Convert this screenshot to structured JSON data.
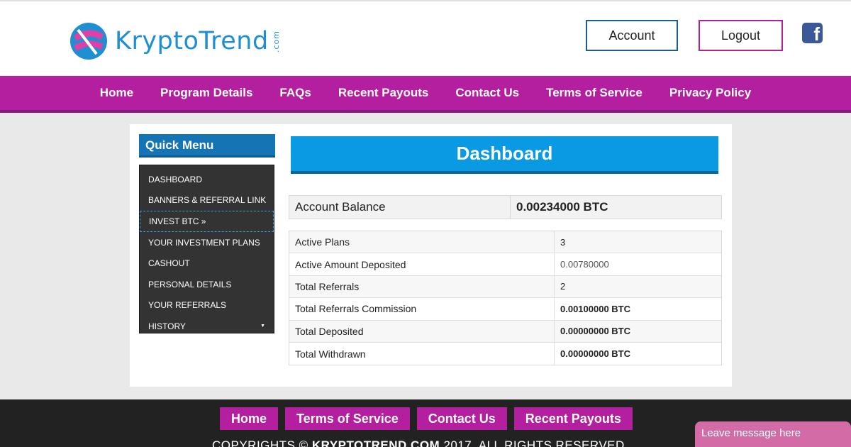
{
  "header": {
    "logo_text": "KryptoTrend",
    "logo_suffix": ".com",
    "account_label": "Account",
    "logout_label": "Logout",
    "facebook_glyph": "f"
  },
  "nav": {
    "items": [
      "Home",
      "Program Details",
      "FAQs",
      "Recent Payouts",
      "Contact Us",
      "Terms of Service",
      "Privacy Policy"
    ]
  },
  "quick_menu": {
    "title": "Quick Menu",
    "items": [
      "DASHBOARD",
      "BANNERS & REFERRAL LINK",
      "INVEST BTC »",
      "YOUR INVESTMENT PLANS",
      "CASHOUT",
      "PERSONAL DETAILS",
      "YOUR REFERRALS",
      "HISTORY"
    ],
    "active_index": 2
  },
  "dashboard": {
    "title": "Dashboard",
    "balance_label": "Account Balance",
    "balance_value": "0.00234000 BTC",
    "stats": [
      {
        "label": "Active Plans",
        "value": "3"
      },
      {
        "label": "Active Amount Deposited",
        "value": "0.00780000"
      },
      {
        "label": "Total Referrals",
        "value": "2"
      },
      {
        "label": "Total Referrals Commission",
        "value": "0.00100000 BTC"
      },
      {
        "label": "Total Deposited",
        "value": "0.00000000 BTC"
      },
      {
        "label": "Total Withdrawn",
        "value": "0.00000000 BTC"
      }
    ]
  },
  "footer": {
    "links": [
      "Home",
      "Terms of Service",
      "Contact Us",
      "Recent Payouts"
    ],
    "copyright_prefix": "COPYRIGHTS © ",
    "copyright_brand": "KRYPTOTREND.COM",
    "copyright_suffix": " 2017. ALL RIGHTS RESERVED",
    "chat_label": "Leave message here"
  },
  "colors": {
    "brand_magenta": "#b31f9f",
    "brand_blue": "#0a9ae4",
    "sidebar_dark": "#333333",
    "footer_dark": "#222222"
  }
}
